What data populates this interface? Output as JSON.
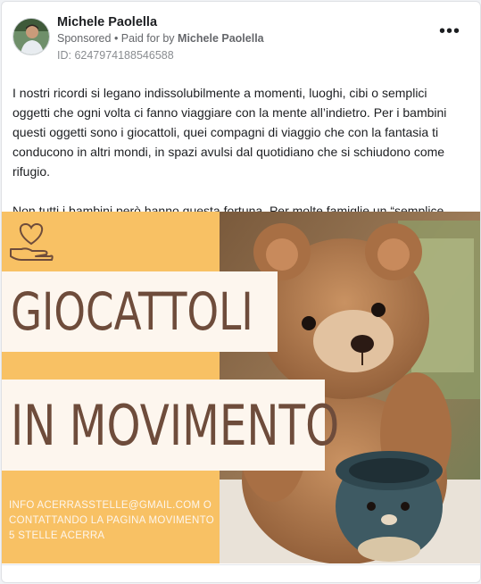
{
  "post": {
    "author": "Michele Paolella",
    "sponsored_label": "Sponsored",
    "paid_for_prefix": "• Paid for by",
    "paid_for_name": "Michele Paolella",
    "ad_id": "ID: 6247974188546588",
    "more_icon": "•••",
    "body_paragraph_1": "I nostri ricordi si legano indissolubilmente a momenti, luoghi, cibi o semplici oggetti che ogni volta ci fanno viaggiare con la mente all’indietro. Per i bambini questi oggetti sono i giocattoli, quei compagni di viaggio che con la fantasia ti conducono in altri mondi, in spazi avulsi dal quotidiano che si schiudono come rifugio.",
    "body_paragraph_2": "Non tutti i bambini però hanno questa fortuna. Per molte famiglie un “semplice…"
  },
  "creative": {
    "title_line_1": "GIOCATTOLI",
    "title_line_2": "IN MOVIMENTO",
    "info_text": "INFO ACERRASSTELLE@GMAIL.COM O CONTATTANDO LA PAGINA MOVIMENTO 5 STELLE ACERRA",
    "background_color": "#f8c164",
    "banner_color": "#fdf6ee",
    "title_color": "#6e4c3b",
    "icons": [
      "heart-hand-icon",
      "teddy-bear-photo"
    ]
  }
}
